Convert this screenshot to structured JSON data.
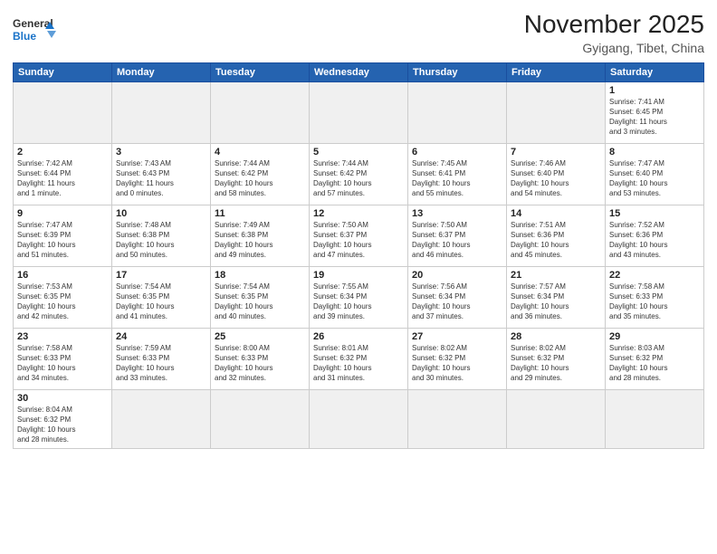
{
  "header": {
    "logo_general": "General",
    "logo_blue": "Blue",
    "month_title": "November 2025",
    "location": "Gyigang, Tibet, China"
  },
  "weekdays": [
    "Sunday",
    "Monday",
    "Tuesday",
    "Wednesday",
    "Thursday",
    "Friday",
    "Saturday"
  ],
  "days": [
    {
      "num": "",
      "info": ""
    },
    {
      "num": "",
      "info": ""
    },
    {
      "num": "",
      "info": ""
    },
    {
      "num": "",
      "info": ""
    },
    {
      "num": "",
      "info": ""
    },
    {
      "num": "",
      "info": ""
    },
    {
      "num": "1",
      "info": "Sunrise: 7:41 AM\nSunset: 6:45 PM\nDaylight: 11 hours\nand 3 minutes."
    },
    {
      "num": "2",
      "info": "Sunrise: 7:42 AM\nSunset: 6:44 PM\nDaylight: 11 hours\nand 1 minute."
    },
    {
      "num": "3",
      "info": "Sunrise: 7:43 AM\nSunset: 6:43 PM\nDaylight: 11 hours\nand 0 minutes."
    },
    {
      "num": "4",
      "info": "Sunrise: 7:44 AM\nSunset: 6:42 PM\nDaylight: 10 hours\nand 58 minutes."
    },
    {
      "num": "5",
      "info": "Sunrise: 7:44 AM\nSunset: 6:42 PM\nDaylight: 10 hours\nand 57 minutes."
    },
    {
      "num": "6",
      "info": "Sunrise: 7:45 AM\nSunset: 6:41 PM\nDaylight: 10 hours\nand 55 minutes."
    },
    {
      "num": "7",
      "info": "Sunrise: 7:46 AM\nSunset: 6:40 PM\nDaylight: 10 hours\nand 54 minutes."
    },
    {
      "num": "8",
      "info": "Sunrise: 7:47 AM\nSunset: 6:40 PM\nDaylight: 10 hours\nand 53 minutes."
    },
    {
      "num": "9",
      "info": "Sunrise: 7:47 AM\nSunset: 6:39 PM\nDaylight: 10 hours\nand 51 minutes."
    },
    {
      "num": "10",
      "info": "Sunrise: 7:48 AM\nSunset: 6:38 PM\nDaylight: 10 hours\nand 50 minutes."
    },
    {
      "num": "11",
      "info": "Sunrise: 7:49 AM\nSunset: 6:38 PM\nDaylight: 10 hours\nand 49 minutes."
    },
    {
      "num": "12",
      "info": "Sunrise: 7:50 AM\nSunset: 6:37 PM\nDaylight: 10 hours\nand 47 minutes."
    },
    {
      "num": "13",
      "info": "Sunrise: 7:50 AM\nSunset: 6:37 PM\nDaylight: 10 hours\nand 46 minutes."
    },
    {
      "num": "14",
      "info": "Sunrise: 7:51 AM\nSunset: 6:36 PM\nDaylight: 10 hours\nand 45 minutes."
    },
    {
      "num": "15",
      "info": "Sunrise: 7:52 AM\nSunset: 6:36 PM\nDaylight: 10 hours\nand 43 minutes."
    },
    {
      "num": "16",
      "info": "Sunrise: 7:53 AM\nSunset: 6:35 PM\nDaylight: 10 hours\nand 42 minutes."
    },
    {
      "num": "17",
      "info": "Sunrise: 7:54 AM\nSunset: 6:35 PM\nDaylight: 10 hours\nand 41 minutes."
    },
    {
      "num": "18",
      "info": "Sunrise: 7:54 AM\nSunset: 6:35 PM\nDaylight: 10 hours\nand 40 minutes."
    },
    {
      "num": "19",
      "info": "Sunrise: 7:55 AM\nSunset: 6:34 PM\nDaylight: 10 hours\nand 39 minutes."
    },
    {
      "num": "20",
      "info": "Sunrise: 7:56 AM\nSunset: 6:34 PM\nDaylight: 10 hours\nand 37 minutes."
    },
    {
      "num": "21",
      "info": "Sunrise: 7:57 AM\nSunset: 6:34 PM\nDaylight: 10 hours\nand 36 minutes."
    },
    {
      "num": "22",
      "info": "Sunrise: 7:58 AM\nSunset: 6:33 PM\nDaylight: 10 hours\nand 35 minutes."
    },
    {
      "num": "23",
      "info": "Sunrise: 7:58 AM\nSunset: 6:33 PM\nDaylight: 10 hours\nand 34 minutes."
    },
    {
      "num": "24",
      "info": "Sunrise: 7:59 AM\nSunset: 6:33 PM\nDaylight: 10 hours\nand 33 minutes."
    },
    {
      "num": "25",
      "info": "Sunrise: 8:00 AM\nSunset: 6:33 PM\nDaylight: 10 hours\nand 32 minutes."
    },
    {
      "num": "26",
      "info": "Sunrise: 8:01 AM\nSunset: 6:32 PM\nDaylight: 10 hours\nand 31 minutes."
    },
    {
      "num": "27",
      "info": "Sunrise: 8:02 AM\nSunset: 6:32 PM\nDaylight: 10 hours\nand 30 minutes."
    },
    {
      "num": "28",
      "info": "Sunrise: 8:02 AM\nSunset: 6:32 PM\nDaylight: 10 hours\nand 29 minutes."
    },
    {
      "num": "29",
      "info": "Sunrise: 8:03 AM\nSunset: 6:32 PM\nDaylight: 10 hours\nand 28 minutes."
    },
    {
      "num": "30",
      "info": "Sunrise: 8:04 AM\nSunset: 6:32 PM\nDaylight: 10 hours\nand 28 minutes."
    }
  ]
}
